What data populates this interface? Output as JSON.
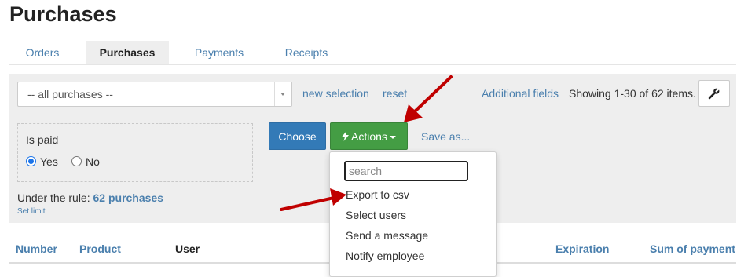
{
  "page": {
    "title": "Purchases"
  },
  "tabs": [
    {
      "label": "Orders"
    },
    {
      "label": "Purchases",
      "active": true
    },
    {
      "label": "Payments"
    },
    {
      "label": "Receipts"
    }
  ],
  "toolbar": {
    "select_value": "-- all purchases --",
    "new_selection": "new selection",
    "reset": "reset",
    "additional_fields": "Additional fields",
    "showing": "Showing 1-30 of 62 items.",
    "settings_icon": "wrench-icon"
  },
  "filter": {
    "label": "Is paid",
    "options": [
      {
        "label": "Yes",
        "checked": true
      },
      {
        "label": "No",
        "checked": false
      }
    ]
  },
  "summary": {
    "prefix": "Under the rule:",
    "count": "62 purchases",
    "set_limit": "Set limit"
  },
  "buttons": {
    "choose": "Choose",
    "actions": "Actions",
    "actions_icon": "bolt-icon",
    "save_as": "Save as..."
  },
  "dropdown": {
    "search_placeholder": "search",
    "items": [
      "Export to csv",
      "Select users",
      "Send a message",
      "Notify employee"
    ]
  },
  "table": {
    "headers": [
      "Number",
      "Product",
      "User",
      "Expiration",
      "Sum of payment"
    ]
  },
  "colors": {
    "link": "#4a7fad",
    "primary": "#337ab7",
    "success": "#449d44",
    "annotation_arrow": "#c00000"
  }
}
